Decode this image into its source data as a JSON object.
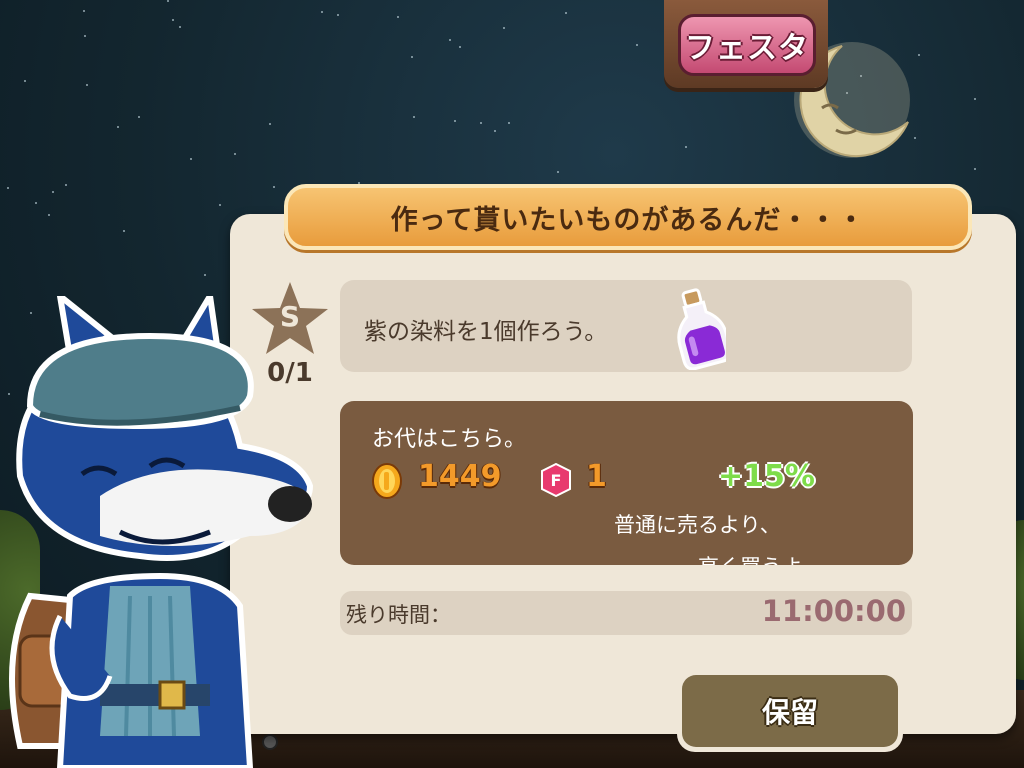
{
  "header": {
    "festa_button_label": "フェスタ"
  },
  "request_panel": {
    "title": "作って貰いたいものがあるんだ・・・",
    "rank_letter": "S",
    "progress": "0/1",
    "quest_text": "紫の染料を1個作ろう。",
    "quest_item_icon": "purple-potion-icon"
  },
  "reward": {
    "title": "お代はこちら。",
    "coins": "1449",
    "gems": "1",
    "gem_icon_letter": "F",
    "bonus": "+15%",
    "note_line1": "普通に売るより、",
    "note_line2": "高く買うよ"
  },
  "time": {
    "label": "残り時間：",
    "value": "11:00:00"
  },
  "actions": {
    "hold_label": "保留"
  },
  "colors": {
    "panel": "#efe7d8",
    "banner": "#f0a848",
    "reward_bg": "#7a5b40",
    "coin_text": "#f39a2a",
    "bonus_text": "#7edc4a",
    "button": "#7c6b48"
  }
}
